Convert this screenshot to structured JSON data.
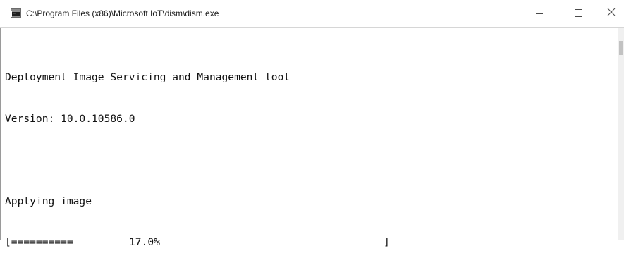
{
  "window": {
    "title": "C:\\Program Files (x86)\\Microsoft IoT\\dism\\dism.exe",
    "icon": "console-app-icon",
    "controls": [
      "minimize-icon",
      "maximize-icon",
      "close-icon"
    ]
  },
  "console": {
    "lines": [
      "Deployment Image Servicing and Management tool",
      "Version: 10.0.10586.0",
      "",
      "Applying image"
    ],
    "progress": {
      "bar_text": "[==========",
      "percent_text": "17.0%",
      "bar_end": "]",
      "value": 0.17
    }
  }
}
